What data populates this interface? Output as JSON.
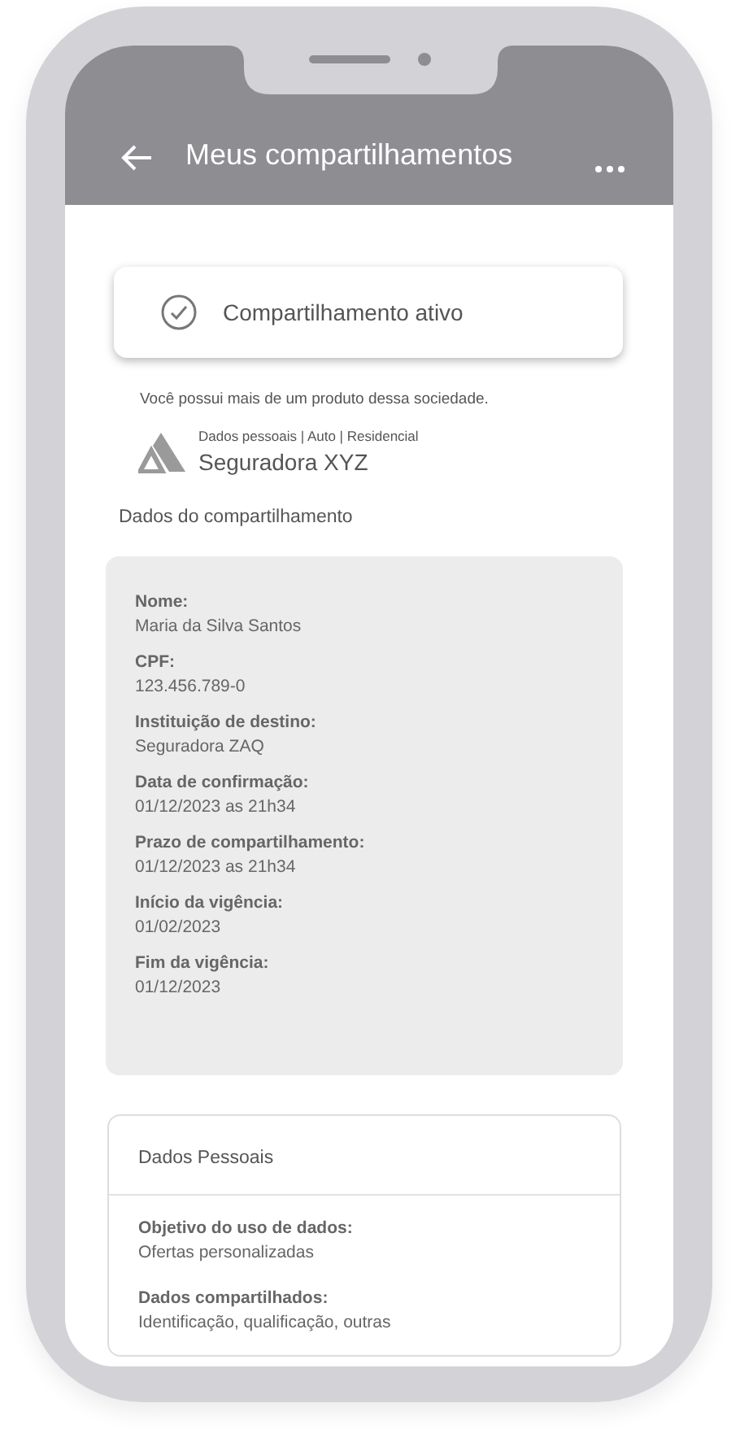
{
  "header": {
    "title": "Meus compartilhamentos"
  },
  "status": {
    "label": "Compartilhamento ativo"
  },
  "notice": "Você possui mais de um produto dessa sociedade.",
  "institution": {
    "categories": "Dados pessoais | Auto | Residencial",
    "name": "Seguradora XYZ"
  },
  "section_title": "Dados do compartilhamento",
  "details": [
    {
      "label": "Nome:",
      "value": "Maria da Silva Santos"
    },
    {
      "label": "CPF:",
      "value": "123.456.789-0"
    },
    {
      "label": "Instituição de destino:",
      "value": "Seguradora ZAQ"
    },
    {
      "label": "Data de confirmação:",
      "value": "01/12/2023 as 21h34"
    },
    {
      "label": "Prazo de compartilhamento:",
      "value": "01/12/2023 as 21h34"
    },
    {
      "label": "Início da vigência:",
      "value": "01/02/2023"
    },
    {
      "label": "Fim da vigência:",
      "value": "01/12/2023"
    }
  ],
  "personal_card": {
    "title": "Dados Pessoais",
    "items": [
      {
        "label": "Objetivo do uso de dados:",
        "value": "Ofertas personalizadas"
      },
      {
        "label": "Dados compartilhados:",
        "value": "Identificação, qualificação, outras"
      }
    ]
  }
}
